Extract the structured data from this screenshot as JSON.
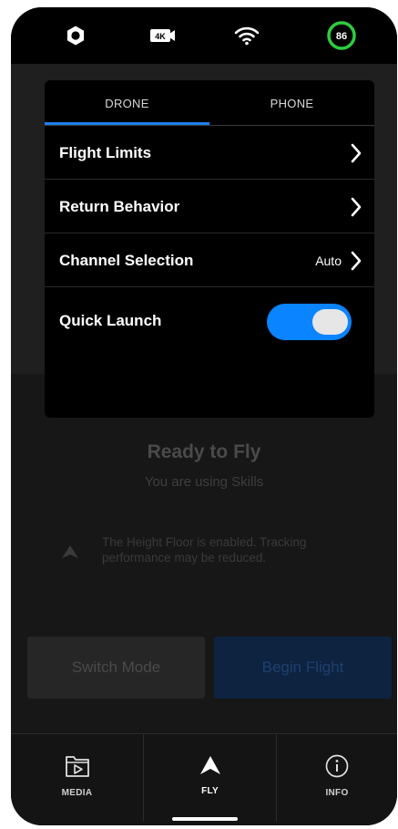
{
  "status_bar": {
    "settings_icon": "gear-icon",
    "camera_mode_icon": "4k-video-icon",
    "camera_mode_label": "4K",
    "wifi_icon": "wifi-icon",
    "battery_level": "86",
    "battery_ring_color": "#2ecc40"
  },
  "settings_panel": {
    "tabs": [
      {
        "label": "DRONE",
        "active": true
      },
      {
        "label": "PHONE",
        "active": false
      }
    ],
    "rows": [
      {
        "label": "Flight Limits",
        "value": ""
      },
      {
        "label": "Return Behavior",
        "value": ""
      },
      {
        "label": "Channel Selection",
        "value": "Auto"
      }
    ],
    "quick_launch": {
      "label": "Quick Launch",
      "enabled": true
    }
  },
  "background": {
    "ready_title": "Ready to Fly",
    "ready_subtitle": "You are using Skills",
    "notice": "The Height Floor is enabled. Tracking performance may be reduced.",
    "switch_mode_label": "Switch Mode",
    "begin_flight_label": "Begin Flight"
  },
  "bottom_nav": {
    "items": [
      {
        "label": "MEDIA",
        "icon": "media-folder-icon"
      },
      {
        "label": "FLY",
        "icon": "fly-arrow-icon"
      },
      {
        "label": "INFO",
        "icon": "info-icon"
      }
    ]
  },
  "colors": {
    "accent": "#1e7ef2",
    "toggle_on": "#0a84ff",
    "panel_bg": "#000000"
  }
}
